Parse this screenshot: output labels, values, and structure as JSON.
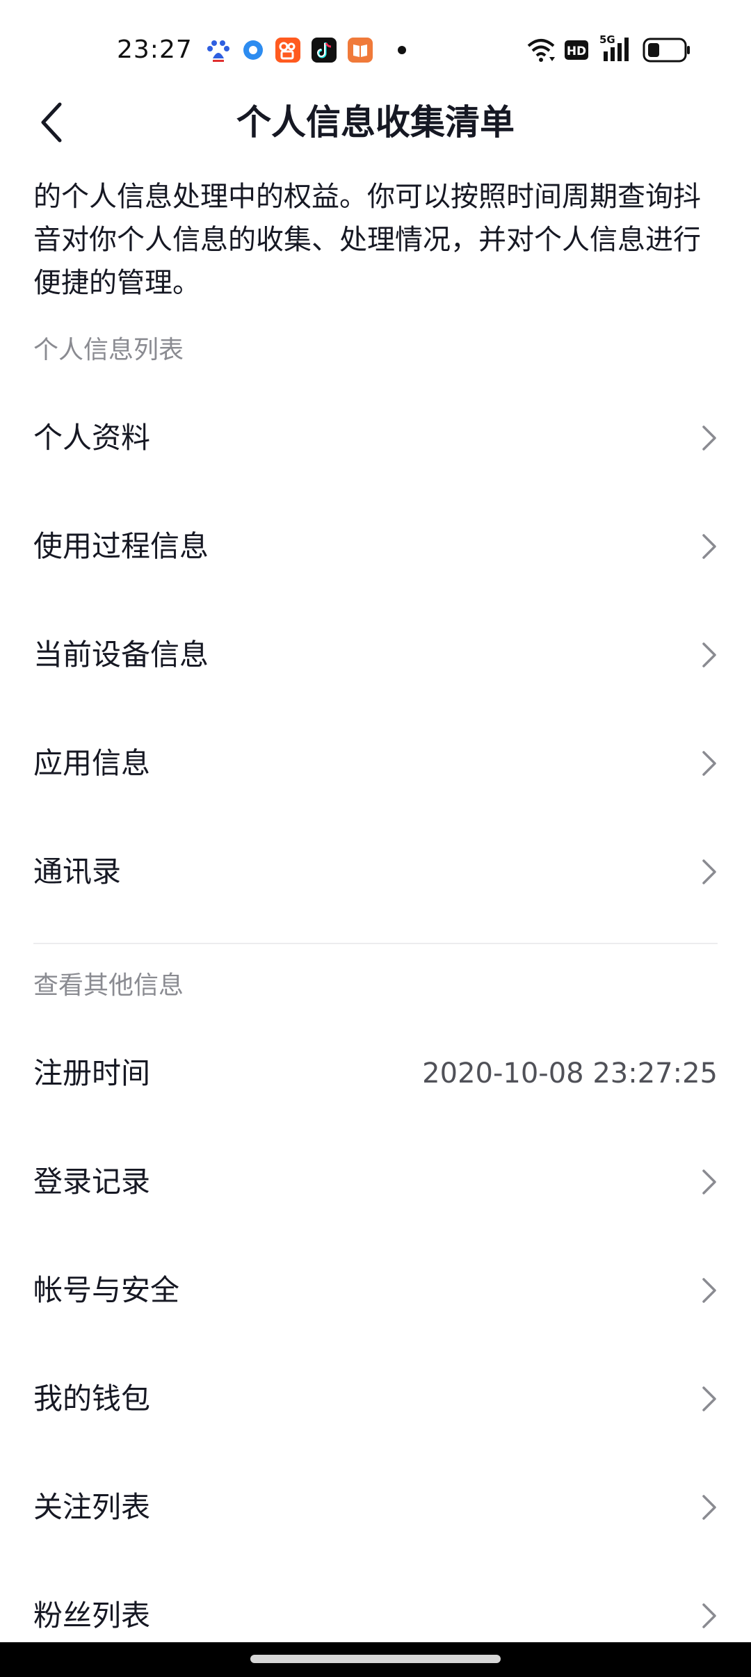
{
  "status_bar": {
    "time": "23:27",
    "network": "5G",
    "hd": "HD",
    "icons": [
      "baidu-app-icon",
      "browser-app-icon",
      "kuaishou-app-icon",
      "douyin-app-icon",
      "reader-app-icon",
      "notification-dot-icon",
      "wifi-icon",
      "hd-icon",
      "signal-5g-icon",
      "battery-icon"
    ]
  },
  "header": {
    "title": "个人信息收集清单",
    "back_icon": "chevron-left-icon"
  },
  "intro_text": "的个人信息处理中的权益。你可以按照时间周期查询抖音对你个人信息的收集、处理情况，并对个人信息进行便捷的管理。",
  "section_personal": {
    "title": "个人信息列表",
    "items": [
      {
        "label": "个人资料"
      },
      {
        "label": "使用过程信息"
      },
      {
        "label": "当前设备信息"
      },
      {
        "label": "应用信息"
      },
      {
        "label": "通讯录"
      }
    ]
  },
  "section_other": {
    "title": "查看其他信息",
    "register": {
      "label": "注册时间",
      "value": "2020-10-08 23:27:25"
    },
    "items": [
      {
        "label": "登录记录"
      },
      {
        "label": "帐号与安全"
      },
      {
        "label": "我的钱包"
      },
      {
        "label": "关注列表"
      },
      {
        "label": "粉丝列表"
      }
    ]
  },
  "colors": {
    "text_primary": "#161823",
    "text_secondary": "#8a8b91",
    "chevron": "#8a8b91",
    "divider": "#ececee",
    "background": "#ffffff"
  }
}
